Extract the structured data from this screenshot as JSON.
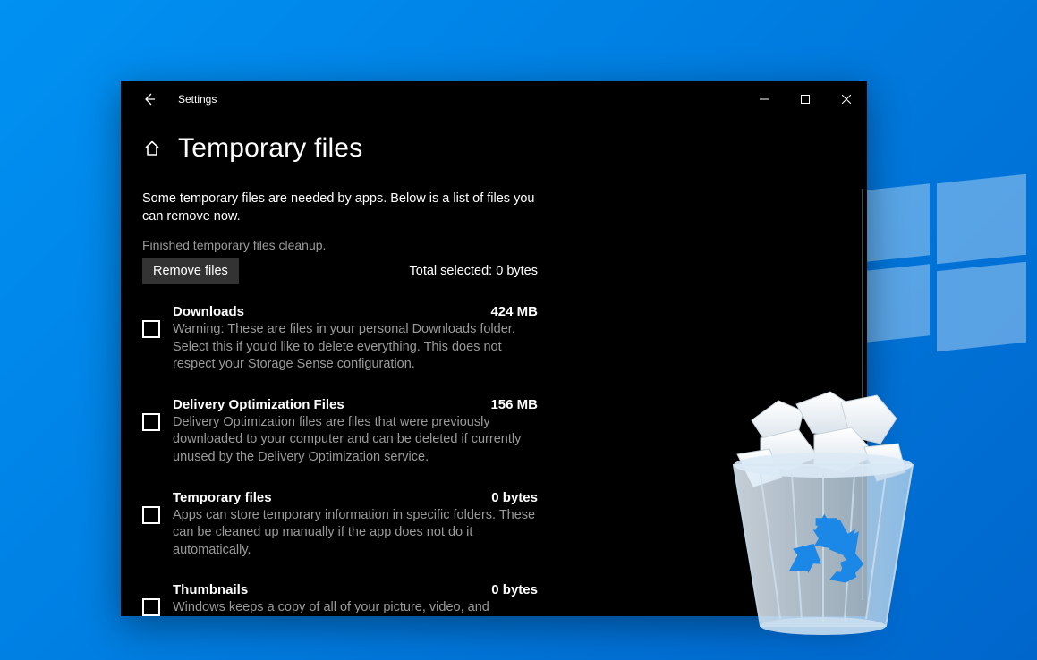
{
  "window": {
    "app_name": "Settings",
    "page_title": "Temporary files",
    "intro": "Some temporary files are needed by apps. Below is a list of files you can remove now.",
    "status": "Finished temporary files cleanup.",
    "remove_button": "Remove files",
    "total_selected_label": "Total selected:",
    "total_selected_value": "0 bytes"
  },
  "items": [
    {
      "name": "Downloads",
      "size": "424 MB",
      "desc": "Warning: These are files in your personal Downloads folder. Select this if you'd like to delete everything. This does not respect your Storage Sense configuration."
    },
    {
      "name": "Delivery Optimization Files",
      "size": "156 MB",
      "desc": "Delivery Optimization files are files that were previously downloaded to your computer and can be deleted if currently unused by the Delivery Optimization service."
    },
    {
      "name": "Temporary files",
      "size": "0 bytes",
      "desc": "Apps can store temporary information in specific folders. These can be cleaned up manually if the app does not do it automatically."
    },
    {
      "name": "Thumbnails",
      "size": "0 bytes",
      "desc": "Windows keeps a copy of all of your picture, video, and document thumbnails so they can be displayed quickly when you open a folder. If you delete these thumbnails, they will be"
    }
  ]
}
